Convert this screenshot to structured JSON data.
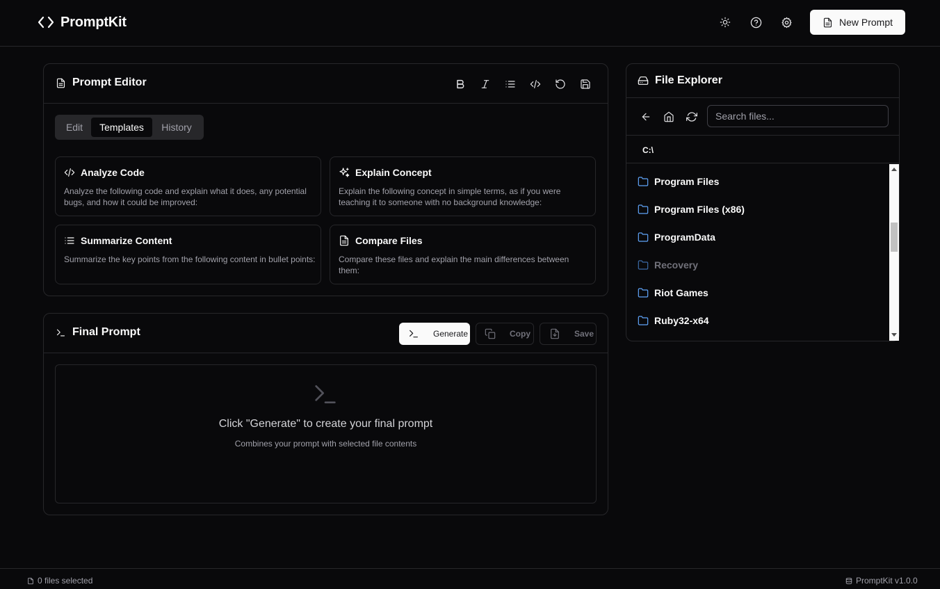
{
  "app": {
    "name": "PromptKit",
    "new_prompt_label": "New Prompt",
    "header_icons": [
      "sun-icon",
      "help-icon",
      "gear-icon"
    ]
  },
  "editor": {
    "title": "Prompt Editor",
    "toolbar": [
      "bold-icon",
      "italic-icon",
      "list-icon",
      "code-icon",
      "undo-icon",
      "save-icon"
    ],
    "tabs": [
      {
        "label": "Edit",
        "active": false
      },
      {
        "label": "Templates",
        "active": true
      },
      {
        "label": "History",
        "active": false
      }
    ],
    "templates": [
      {
        "title": "Analyze Code",
        "icon": "code-icon",
        "description": "Analyze the following code and explain what it does, any potential bugs, and how it could be improved:"
      },
      {
        "title": "Explain Concept",
        "icon": "sparkles-icon",
        "description": "Explain the following concept in simple terms, as if you were teaching it to someone with no background knowledge:"
      },
      {
        "title": "Summarize Content",
        "icon": "list-icon",
        "description": "Summarize the key points from the following content in bullet points:"
      },
      {
        "title": "Compare Files",
        "icon": "file-text-icon",
        "description": "Compare these files and explain the main differences between them:"
      }
    ]
  },
  "final_prompt": {
    "title": "Final Prompt",
    "generate_label": "Generate",
    "copy_label": "Copy",
    "save_label": "Save",
    "empty_title": "Click \"Generate\" to create your final prompt",
    "empty_subtitle": "Combines your prompt with selected file contents"
  },
  "explorer": {
    "title": "File Explorer",
    "search_placeholder": "Search files...",
    "current_path": "C:\\",
    "folders": [
      {
        "name": "Program Files",
        "dim": false
      },
      {
        "name": "Program Files (x86)",
        "dim": false
      },
      {
        "name": "ProgramData",
        "dim": false
      },
      {
        "name": "Recovery",
        "dim": true
      },
      {
        "name": "Riot Games",
        "dim": false
      },
      {
        "name": "Ruby32-x64",
        "dim": false
      }
    ]
  },
  "footer": {
    "files_selected": "0 files selected",
    "version": "PromptKit v1.0.0"
  },
  "colors": {
    "background": "#09090b",
    "border": "#27272a",
    "folder_icon": "#60a5fa",
    "muted_text": "#a1a1aa"
  }
}
